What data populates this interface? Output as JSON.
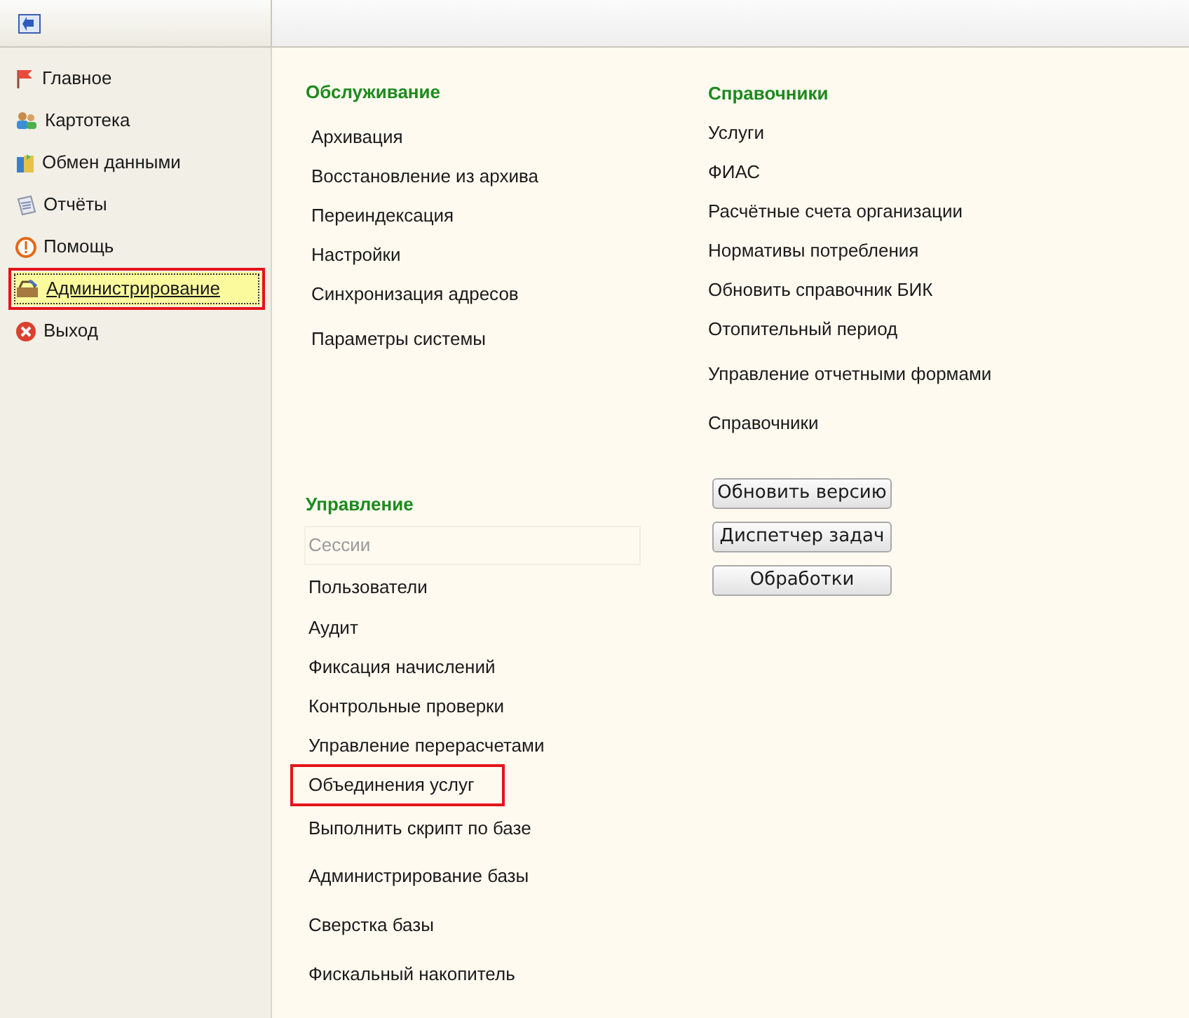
{
  "sidebar": {
    "items": [
      {
        "label": "Главное",
        "selected": false,
        "highlighted": false
      },
      {
        "label": "Картотека",
        "selected": false,
        "highlighted": false
      },
      {
        "label": "Обмен данными",
        "selected": false,
        "highlighted": false
      },
      {
        "label": "Отчёты",
        "selected": false,
        "highlighted": false
      },
      {
        "label": "Помощь",
        "selected": false,
        "highlighted": false
      },
      {
        "label": "Администрирование",
        "selected": true,
        "highlighted": true
      },
      {
        "label": "Выход",
        "selected": false,
        "highlighted": false
      }
    ]
  },
  "maintenance": {
    "title": "Обслуживание",
    "items": [
      {
        "label": "Архивация",
        "disabled": false,
        "highlighted": false
      },
      {
        "label": "Восстановление из архива",
        "disabled": false,
        "highlighted": false
      },
      {
        "label": "Переиндексация",
        "disabled": false,
        "highlighted": false
      },
      {
        "label": "Настройки",
        "disabled": false,
        "highlighted": false
      },
      {
        "label": "Синхронизация адресов",
        "disabled": false,
        "highlighted": false
      },
      {
        "label": "Параметры системы",
        "disabled": false,
        "highlighted": false
      }
    ]
  },
  "references": {
    "title": "Справочники",
    "items": [
      {
        "label": "Услуги",
        "disabled": false,
        "highlighted": false
      },
      {
        "label": "ФИАС",
        "disabled": false,
        "highlighted": false
      },
      {
        "label": "Расчётные счета организации",
        "disabled": false,
        "highlighted": false
      },
      {
        "label": "Нормативы потребления",
        "disabled": false,
        "highlighted": false
      },
      {
        "label": "Обновить справочник БИК",
        "disabled": false,
        "highlighted": false
      },
      {
        "label": "Отопительный период",
        "disabled": false,
        "highlighted": false
      },
      {
        "label": "Управление отчетными формами",
        "disabled": false,
        "highlighted": false
      },
      {
        "label": "Справочники",
        "disabled": false,
        "highlighted": false
      }
    ],
    "buttons": [
      "Обновить версию",
      "Диспетчер задач",
      "Обработки"
    ]
  },
  "management": {
    "title": "Управление",
    "items": [
      {
        "label": "Сессии",
        "disabled": true,
        "highlighted": false
      },
      {
        "label": "Пользователи",
        "disabled": false,
        "highlighted": false
      },
      {
        "label": "Аудит",
        "disabled": false,
        "highlighted": false
      },
      {
        "label": "Фиксация начислений",
        "disabled": false,
        "highlighted": false
      },
      {
        "label": "Контрольные проверки",
        "disabled": false,
        "highlighted": false
      },
      {
        "label": "Управление перерасчетами",
        "disabled": false,
        "highlighted": false
      },
      {
        "label": "Объединения услуг",
        "disabled": false,
        "highlighted": true
      },
      {
        "label": "Выполнить скрипт по базе",
        "disabled": false,
        "highlighted": false
      },
      {
        "label": "Администрирование базы",
        "disabled": false,
        "highlighted": false
      },
      {
        "label": "Сверстка базы",
        "disabled": false,
        "highlighted": false
      },
      {
        "label": "Фискальный накопитель",
        "disabled": false,
        "highlighted": false
      }
    ]
  }
}
